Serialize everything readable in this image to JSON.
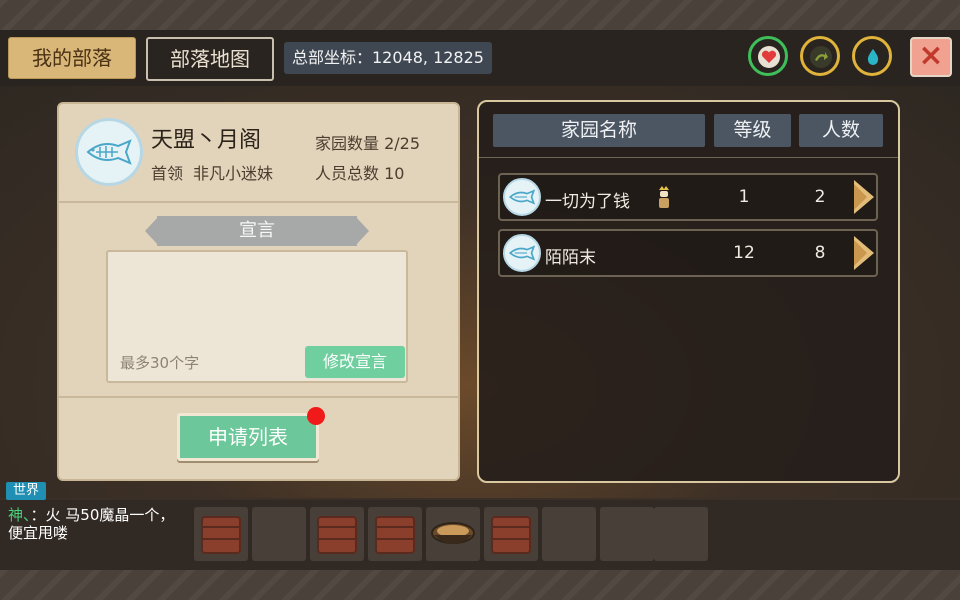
{
  "tabs": {
    "my_tribe": "我的部落",
    "tribe_map": "部落地图"
  },
  "hq_coords": "总部坐标：12048, 12825",
  "status_icons": [
    {
      "name": "heart-icon",
      "ring": "#3fbf5a",
      "glyph": "❤",
      "color": "#e23b3b"
    },
    {
      "name": "stamina-icon",
      "ring": "#e0b43a",
      "glyph": "➜",
      "color": "#8a9a3a"
    },
    {
      "name": "water-icon",
      "ring": "#e0b43a",
      "glyph": "💧",
      "color": "#2ab4c8"
    }
  ],
  "close_label": "×",
  "tribe": {
    "name": "天盟丶月阁",
    "leader_label": "首领",
    "leader_name": "非凡小迷妹",
    "home_count": "家园数量 2/25",
    "member_count": "人员总数 10"
  },
  "declaration": {
    "title": "宣言",
    "placeholder": "最多30个字",
    "edit_button": "修改宣言"
  },
  "apply_list_button": "申请列表",
  "home_list": {
    "headers": {
      "name": "家园名称",
      "level": "等级",
      "members": "人数"
    },
    "rows": [
      {
        "name": "一切为了钱",
        "level": "1",
        "members": "2",
        "is_leader": true
      },
      {
        "name": "陌陌末",
        "level": "12",
        "members": "8",
        "is_leader": false
      }
    ]
  },
  "chat": {
    "channel": "世界",
    "speaker": "神、",
    "message": "：火 马50魔晶一个，便宜甩喽"
  },
  "inventory": {
    "slots": [
      "chest",
      "empty",
      "chest",
      "chest",
      "food-bowl",
      "chest",
      "empty",
      "empty",
      "empty"
    ]
  }
}
